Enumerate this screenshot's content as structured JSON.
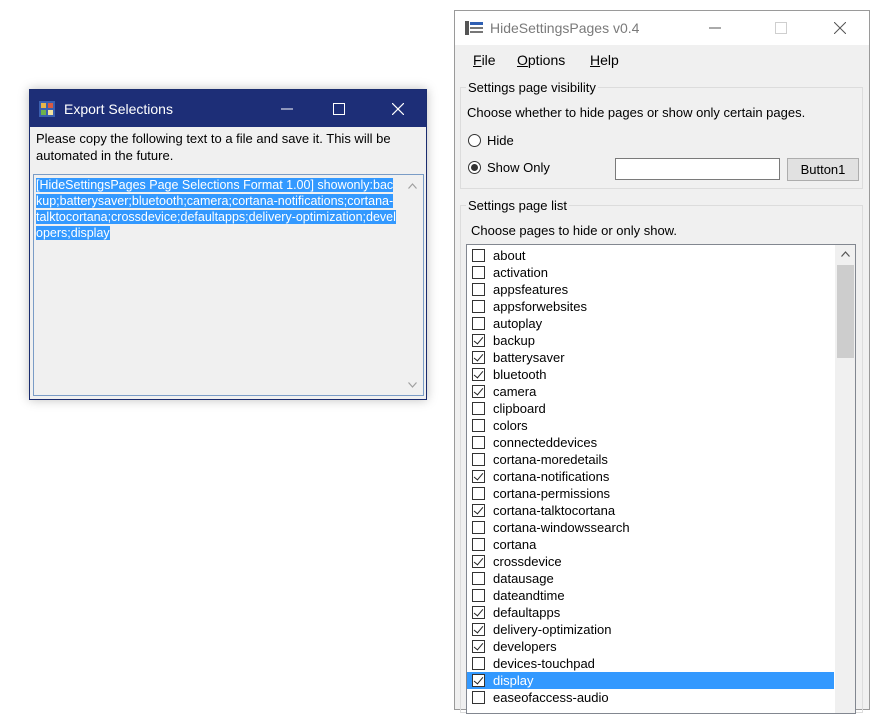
{
  "export_window": {
    "title": "Export Selections",
    "description": "Please copy the following text to a file and save it. This will be automated in the future.",
    "selected_text": "[HideSettingsPages Page Selections Format 1.00] showonly:backup;batterysaver;bluetooth;camera;cortana-notifications;cortana-talktocortana;crossdevice;defaultapps;delivery-optimization;developers;display"
  },
  "main_window": {
    "title": "HideSettingsPages v0.4",
    "menu": [
      {
        "label": "File",
        "accel": "F",
        "rest": "ile"
      },
      {
        "label": "Options",
        "accel": "O",
        "rest": "ptions"
      },
      {
        "label": "Help",
        "accel": "H",
        "rest": "elp"
      }
    ],
    "visibility_group": {
      "legend": "Settings page visibility",
      "description": "Choose whether to hide pages or show only certain pages.",
      "hide_label": "Hide",
      "show_only_label": "Show Only",
      "selected": "Show Only",
      "textbox_value": "",
      "button_label": "Button1"
    },
    "list_group": {
      "legend": "Settings page list",
      "description": "Choose pages to hide or only show.",
      "items": [
        {
          "label": "about",
          "checked": false
        },
        {
          "label": "activation",
          "checked": false
        },
        {
          "label": "appsfeatures",
          "checked": false
        },
        {
          "label": "appsforwebsites",
          "checked": false
        },
        {
          "label": "autoplay",
          "checked": false
        },
        {
          "label": "backup",
          "checked": true
        },
        {
          "label": "batterysaver",
          "checked": true
        },
        {
          "label": "bluetooth",
          "checked": true
        },
        {
          "label": "camera",
          "checked": true
        },
        {
          "label": "clipboard",
          "checked": false
        },
        {
          "label": "colors",
          "checked": false
        },
        {
          "label": "connecteddevices",
          "checked": false
        },
        {
          "label": "cortana-moredetails",
          "checked": false
        },
        {
          "label": "cortana-notifications",
          "checked": true
        },
        {
          "label": "cortana-permissions",
          "checked": false
        },
        {
          "label": "cortana-talktocortana",
          "checked": true
        },
        {
          "label": "cortana-windowssearch",
          "checked": false
        },
        {
          "label": "cortana",
          "checked": false
        },
        {
          "label": "crossdevice",
          "checked": true
        },
        {
          "label": "datausage",
          "checked": false
        },
        {
          "label": "dateandtime",
          "checked": false
        },
        {
          "label": "defaultapps",
          "checked": true
        },
        {
          "label": "delivery-optimization",
          "checked": true
        },
        {
          "label": "developers",
          "checked": true
        },
        {
          "label": "devices-touchpad",
          "checked": false
        },
        {
          "label": "display",
          "checked": true,
          "selected": true
        },
        {
          "label": "easeofaccess-audio",
          "checked": false
        }
      ]
    }
  },
  "colors": {
    "export_titlebar": "#1d2e77",
    "selection": "#3399ff"
  }
}
